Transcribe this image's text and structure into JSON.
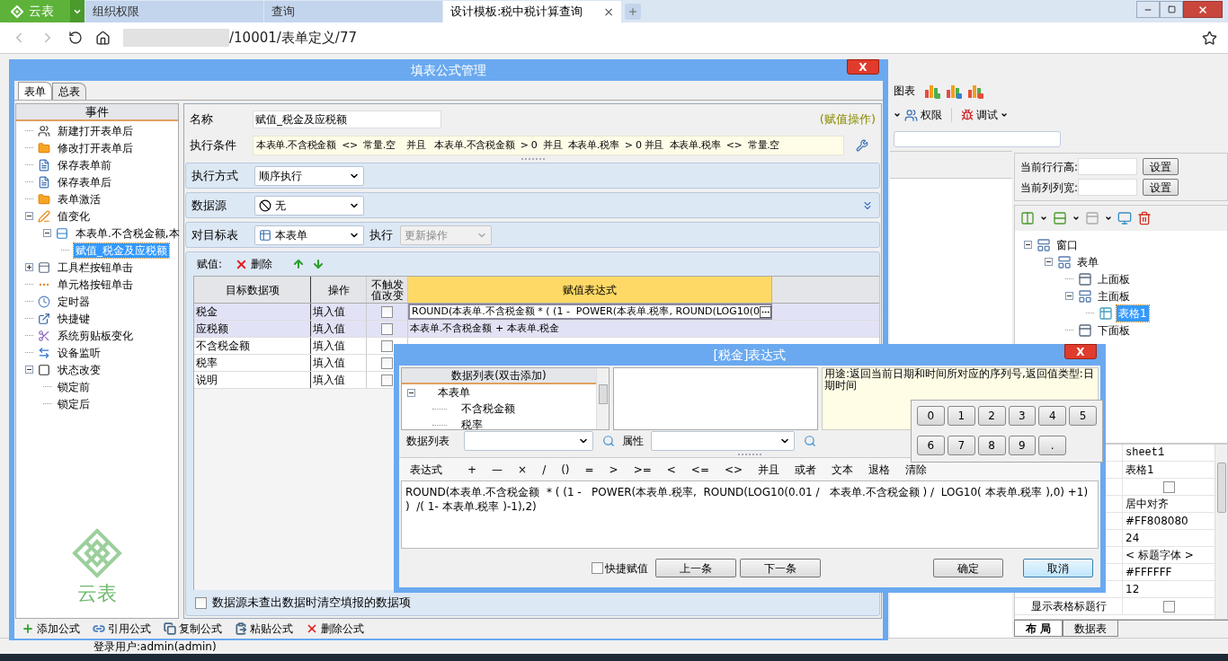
{
  "browser": {
    "brand": "云表",
    "tabs": [
      {
        "label": "组织权限",
        "selected": false
      },
      {
        "label": "查询",
        "selected": false
      },
      {
        "label": "设计模板:税中税计算查询",
        "selected": true
      }
    ],
    "close_tab": "×",
    "url": "/10001/表单定义/77"
  },
  "app": {
    "toolbar": {
      "chart_label": "图表",
      "permission": "权限",
      "debug": "调试"
    },
    "size_panel": {
      "row_height_label": "当前行行高:",
      "col_width_label": "当前列列宽:",
      "set_buttons": [
        "设置",
        "设置"
      ]
    },
    "tree": [
      {
        "label": "窗口",
        "expanded": true,
        "selected": false,
        "children": [
          {
            "label": "表单",
            "expanded": true,
            "selected": false,
            "children": [
              {
                "label": "上面板",
                "selected": false
              },
              {
                "label": "主面板",
                "expanded": true,
                "selected": false,
                "children": [
                  {
                    "label": "表格1",
                    "selected": true
                  }
                ]
              },
              {
                "label": "下面板",
                "selected": false
              }
            ]
          }
        ]
      }
    ],
    "properties": [
      {
        "kind": "text",
        "value": "sheet1"
      },
      {
        "kind": "text",
        "value": "表格1"
      },
      {
        "kind": "check",
        "checked": false
      },
      {
        "kind": "text",
        "value": "居中对齐"
      },
      {
        "kind": "text",
        "value": "#FF808080"
      },
      {
        "kind": "text",
        "value": "24"
      },
      {
        "kind": "text",
        "value": "< 标题字体 >"
      },
      {
        "kind": "text",
        "value": "#FFFFFF"
      },
      {
        "kind": "text",
        "value": "12"
      },
      {
        "kind": "check",
        "name": "显示表格标题行",
        "checked": false
      }
    ],
    "bottom_tabs": [
      {
        "label": "布 局",
        "selected": true
      },
      {
        "label": "数据表",
        "selected": false
      }
    ],
    "status": "登录用户:admin(admin)"
  },
  "formula_dialog": {
    "title": "填表公式管理",
    "close": "X",
    "tabs": [
      {
        "label": "表单",
        "selected": true
      },
      {
        "label": "总表",
        "selected": false
      }
    ],
    "events_header": "事件",
    "events": [
      {
        "label": "新建打开表单后",
        "selected": false
      },
      {
        "label": "修改打开表单后",
        "selected": false
      },
      {
        "label": "保存表单前",
        "selected": false
      },
      {
        "label": "保存表单后",
        "selected": false
      },
      {
        "label": "表单激活",
        "selected": false
      },
      {
        "label": "值变化",
        "expanded": true,
        "selected": false,
        "children": [
          {
            "label": "本表单.不含税金额,本",
            "expanded": true,
            "selected": false,
            "children": [
              {
                "label": "赋值_税金及应税额",
                "selected": true
              }
            ]
          }
        ]
      },
      {
        "label": "工具栏按钮单击",
        "expanded": false,
        "selected": false
      },
      {
        "label": "单元格按钮单击",
        "selected": false
      },
      {
        "label": "定时器",
        "selected": false
      },
      {
        "label": "快捷键",
        "selected": false
      },
      {
        "label": "系统剪贴板变化",
        "selected": false
      },
      {
        "label": "设备监听",
        "selected": false
      },
      {
        "label": "状态改变",
        "expanded": true,
        "selected": false,
        "children": [
          {
            "label": "锁定前",
            "selected": false
          },
          {
            "label": "锁定后",
            "selected": false
          }
        ]
      }
    ],
    "logo_text": "云表",
    "name_label": "名称",
    "name_value": "赋值_税金及应税额",
    "op_type": "(赋值操作)",
    "condition_label": "执行条件",
    "condition": "本表单.不含税金额  <>  常量.空    并且   本表单.不含税金额  > 0  并且  本表单.税率  > 0 并且  本表单.税率  <>  常量.空",
    "exec_mode": {
      "label": "执行方式",
      "value": "顺序执行"
    },
    "datasource": {
      "label": "数据源",
      "value": "无"
    },
    "target": {
      "label": "对目标表",
      "value": "本表单",
      "exec_label": "执行",
      "exec_value": "更新操作",
      "exec_disabled": true
    },
    "assign": {
      "label": "赋值:",
      "delete": "删除",
      "columns": [
        "目标数据项",
        "操作",
        "不触发值改变",
        "赋值表达式"
      ],
      "rows": [
        {
          "target": "税金",
          "op": "填入值",
          "no_trigger": false,
          "expression": "ROUND(本表单.不含税金额 * ( (1 -  POWER(本表单.税率, ROUND(LOG10(0",
          "selected": true
        },
        {
          "target": "应税额",
          "op": "填入值",
          "no_trigger": false,
          "expression": "本表单.不含税金额 + 本表单.税金",
          "selected": true
        },
        {
          "target": "不含税金额",
          "op": "填入值",
          "no_trigger": false,
          "selected": false
        },
        {
          "target": "税率",
          "op": "填入值",
          "no_trigger": false,
          "selected": false
        },
        {
          "target": "说明",
          "op": "填入值",
          "no_trigger": false,
          "selected": false
        }
      ]
    },
    "clear_option": {
      "label": "数据源未查出数据时清空填报的数据项",
      "checked": false
    },
    "actions": [
      "添加公式",
      "引用公式",
      "复制公式",
      "粘贴公式",
      "删除公式"
    ]
  },
  "expression_dialog": {
    "title": "[税金]表达式",
    "close": "X",
    "list_header": "数据列表(双击添加)",
    "field_tree": {
      "root": "本表单",
      "expanded": true,
      "children": [
        "不含税金额",
        "税率"
      ]
    },
    "description": "用途:返回当前日期和时间所对应的序列号,返回值类型:日期时间",
    "datalist_label": "数据列表",
    "property_label": "属性",
    "expression_label": "表达式",
    "operators": [
      "+",
      "—",
      "×",
      "/",
      "()",
      "=",
      ">",
      ">=",
      "<",
      "<=",
      "<>",
      "并且",
      "或者",
      "文本",
      "退格",
      "清除"
    ],
    "expression": "ROUND(本表单.不含税金额  * ( (1 -   POWER(本表单.税率,  ROUND(LOG10(0.01 /   本表单.不含税金额 ) /  LOG10( 本表单.税率 ),0) +1) )  /( 1- 本表单.税率 )-1),2)",
    "quick_assign": {
      "label": "快捷赋值",
      "checked": false
    },
    "nav_buttons": [
      "上一条",
      "下一条"
    ],
    "ok": "确定",
    "cancel": "取消",
    "keypad": [
      "0",
      "1",
      "2",
      "3",
      "4",
      "5",
      "6",
      "7",
      "8",
      "9",
      "."
    ]
  }
}
